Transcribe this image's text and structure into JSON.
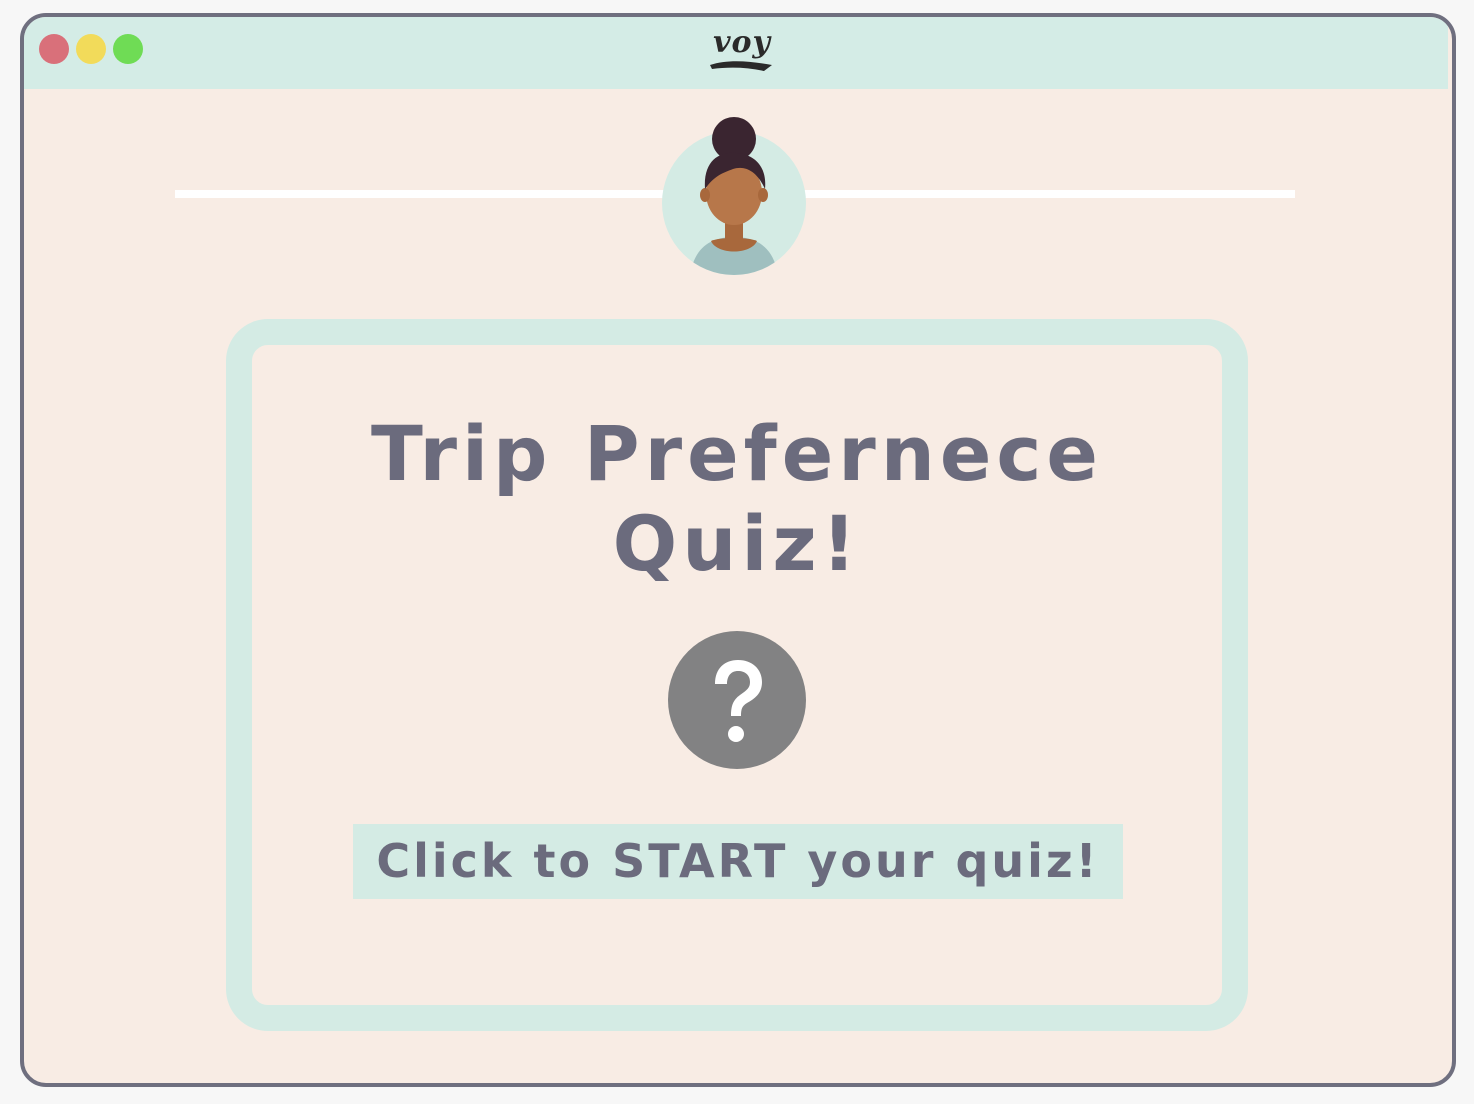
{
  "window": {
    "controls": {
      "close_color": "#d9707a",
      "minimize_color": "#f2db5a",
      "maximize_color": "#6fdc55"
    },
    "logo_text": "voy",
    "accent_color": "#d4ebe4",
    "background_color": "#f8ece4"
  },
  "header": {
    "avatar_icon": "woman-avatar-icon"
  },
  "quiz_card": {
    "title": "Trip Prefernece Quiz!",
    "icon": "question-mark-icon",
    "start_button_label": "Click to START your quiz!"
  }
}
